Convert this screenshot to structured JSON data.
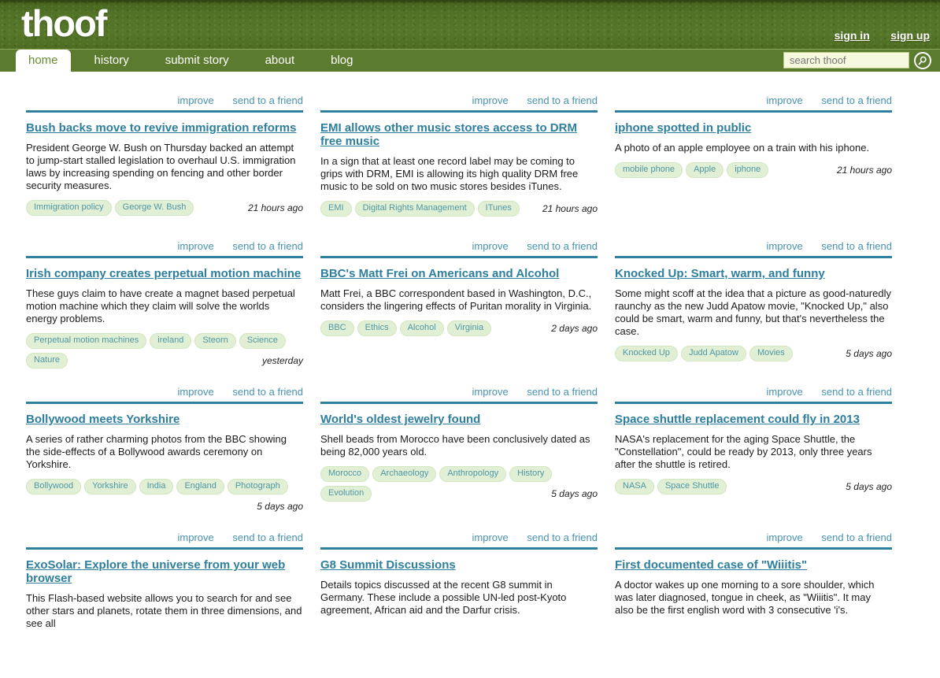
{
  "brand": {
    "logo_text": "thoof"
  },
  "header": {
    "auth": {
      "sign_in": "sign in",
      "sign_up": "sign up"
    },
    "nav": [
      {
        "label": "home",
        "active": true
      },
      {
        "label": "history",
        "active": false
      },
      {
        "label": "submit story",
        "active": false
      },
      {
        "label": "about",
        "active": false
      },
      {
        "label": "blog",
        "active": false
      }
    ],
    "search": {
      "placeholder": "search thoof"
    }
  },
  "card_actions": {
    "improve": "improve",
    "send": "send to a friend"
  },
  "stories": [
    {
      "title": "Bush backs move to revive immigration reforms",
      "description": "President George W. Bush on Thursday backed an attempt to jump-start stalled legislation to overhaul U.S. immigration laws by increasing spending on fencing and other border security measures.",
      "tags": [
        "Immigration policy",
        "George W. Bush"
      ],
      "time": "21 hours ago"
    },
    {
      "title": "EMI allows other music stores access to DRM free music",
      "description": "In a sign that at least one record label may be coming to grips with DRM, EMI is allowing its high quality DRM free music to be sold on two music stores besides iTunes.",
      "tags": [
        "EMI",
        "Digital Rights Management",
        "ITunes"
      ],
      "time": "21 hours ago"
    },
    {
      "title": "iphone spotted in public",
      "description": "A photo of an apple employee on a train with his iphone.",
      "tags": [
        "mobile phone",
        "Apple",
        "iphone"
      ],
      "time": "21 hours ago"
    },
    {
      "title": "Irish company creates perpetual motion machine",
      "description": "These guys claim to have create a magnet based perpetual motion machine which they claim will solve the worlds energy problems.",
      "tags": [
        "Perpetual motion machines",
        "ireland",
        "Steorn",
        "Science",
        "Nature"
      ],
      "time": "yesterday"
    },
    {
      "title": "BBC's Matt Frei on Americans and Alcohol",
      "description": "Matt Frei, a BBC correspondent based in Washington, D.C., considers the lingering effects of Puritan morality in Virginia.",
      "tags": [
        "BBC",
        "Ethics",
        "Alcohol",
        "Virginia"
      ],
      "time": "2 days ago"
    },
    {
      "title": "Knocked Up: Smart, warm, and funny",
      "description": "Some might scoff at the idea that a picture as good-naturedly raunchy as the new Judd Apatow movie, \"Knocked Up,\" also could be smart, warm and funny, but that's nevertheless the case.",
      "tags": [
        "Knocked Up",
        "Judd Apatow",
        "Movies"
      ],
      "time": "5 days ago"
    },
    {
      "title": "Bollywood meets Yorkshire",
      "description": "A series of rather charming photos from the BBC showing the side-effects of a Bollywood awards ceremony on Yorkshire.",
      "tags": [
        "Bollywood",
        "Yorkshire",
        "India",
        "England",
        "Photograph"
      ],
      "time": "5 days ago"
    },
    {
      "title": "World's oldest jewelry found",
      "description": "Shell beads from Morocco have been conclusively dated as being 82,000 years old.",
      "tags": [
        "Morocco",
        "Archaeology",
        "Anthropology",
        "History",
        "Evolution"
      ],
      "time": "5 days ago"
    },
    {
      "title": "Space shuttle replacement could fly in 2013",
      "description": "NASA's replacement for the aging Space Shuttle, the \"Constellation\", could be ready by 2013, only three years after the shuttle is retired.",
      "tags": [
        "NASA",
        "Space Shuttle"
      ],
      "time": "5 days ago"
    },
    {
      "title": "ExoSolar: Explore the universe from your web browser",
      "description": "This Flash-based website allows you to search for and see other stars and planets, rotate them in three dimensions, and see all",
      "tags": [],
      "time": ""
    },
    {
      "title": "G8 Summit Discussions",
      "description": "Details topics discussed at the recent G8 summit in Germany. These include a possible UN-led post-Kyoto agreement, African aid and the Darfur crisis.",
      "tags": [],
      "time": ""
    },
    {
      "title": "First documented case of \"Wiiitis\"",
      "description": "A doctor wakes up one morning to a sore shoulder, which was later diagnosed, tongue in cheek, as \"Wiiitis\". It may also be the first english word with 3 consecutive 'i's.",
      "tags": [],
      "time": ""
    }
  ],
  "colors": {
    "header_green": "#4e6d22",
    "navbar_green": "#5b7b2e",
    "active_tab_text": "#678c31",
    "link_teal": "#4792b0",
    "title_teal": "#2e7e9d",
    "rule_teal": "#2f7f9e",
    "tag_bg": "#e1efd4",
    "tag_text": "#4f97a6",
    "search_bg": "#f6f9dd"
  }
}
